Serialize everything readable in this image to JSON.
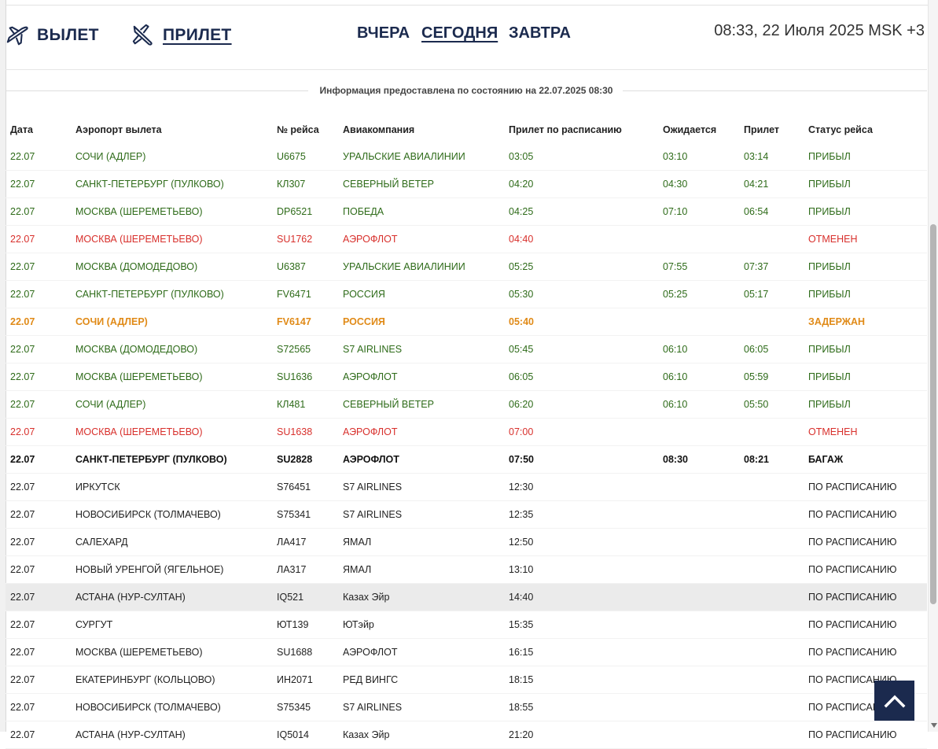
{
  "header": {
    "departure_label": "ВЫЛЕТ",
    "arrival_label": "ПРИЛЕТ",
    "days": {
      "yesterday": "ВЧЕРА",
      "today": "СЕГОДНЯ",
      "tomorrow": "ЗАВТРА"
    },
    "clock": "08:33, 22 Июля 2025 MSK +3"
  },
  "info_text": "Информация предоставлена по состоянию на 22.07.2025 08:30",
  "columns": {
    "date": "Дата",
    "airport": "Аэропорт вылета",
    "flight": "№ рейса",
    "airline": "Авиакомпания",
    "scheduled": "Прилет по расписанию",
    "expected": "Ожидается",
    "arrived": "Прилет",
    "status": "Статус рейса"
  },
  "colors": {
    "navy": "#1b2a4e",
    "arrived": "#2e6b19",
    "cancelled": "#d8302c",
    "delayed": "#e08a17"
  },
  "flights": [
    {
      "date": "22.07",
      "airport": "СОЧИ (АДЛЕР)",
      "flight": "U6675",
      "airline": "УРАЛЬСКИЕ АВИАЛИНИИ",
      "scheduled": "03:05",
      "expected": "03:10",
      "arrived": "03:14",
      "status": "ПРИБЫЛ",
      "state": "ok"
    },
    {
      "date": "22.07",
      "airport": "САНКТ-ПЕТЕРБУРГ (ПУЛКОВО)",
      "flight": "КЛ307",
      "airline": "СЕВЕРНЫЙ ВЕТЕР",
      "scheduled": "04:20",
      "expected": "04:30",
      "arrived": "04:21",
      "status": "ПРИБЫЛ",
      "state": "ok"
    },
    {
      "date": "22.07",
      "airport": "МОСКВА (ШЕРЕМЕТЬЕВО)",
      "flight": "DP6521",
      "airline": "ПОБЕДА",
      "scheduled": "04:25",
      "expected": "07:10",
      "arrived": "06:54",
      "status": "ПРИБЫЛ",
      "state": "ok"
    },
    {
      "date": "22.07",
      "airport": "МОСКВА (ШЕРЕМЕТЬЕВО)",
      "flight": "SU1762",
      "airline": "АЭРОФЛОТ",
      "scheduled": "04:40",
      "expected": "",
      "arrived": "",
      "status": "ОТМЕНЕН",
      "state": "cancel"
    },
    {
      "date": "22.07",
      "airport": "МОСКВА (ДОМОДЕДОВО)",
      "flight": "U6387",
      "airline": "УРАЛЬСКИЕ АВИАЛИНИИ",
      "scheduled": "05:25",
      "expected": "07:55",
      "arrived": "07:37",
      "status": "ПРИБЫЛ",
      "state": "ok"
    },
    {
      "date": "22.07",
      "airport": "САНКТ-ПЕТЕРБУРГ (ПУЛКОВО)",
      "flight": "FV6471",
      "airline": "РОССИЯ",
      "scheduled": "05:30",
      "expected": "05:25",
      "arrived": "05:17",
      "status": "ПРИБЫЛ",
      "state": "ok"
    },
    {
      "date": "22.07",
      "airport": "СОЧИ (АДЛЕР)",
      "flight": "FV6147",
      "airline": "РОССИЯ",
      "scheduled": "05:40",
      "expected": "",
      "arrived": "",
      "status": "ЗАДЕРЖАН",
      "state": "delay"
    },
    {
      "date": "22.07",
      "airport": "МОСКВА (ДОМОДЕДОВО)",
      "flight": "S72565",
      "airline": "S7 AIRLINES",
      "scheduled": "05:45",
      "expected": "06:10",
      "arrived": "06:05",
      "status": "ПРИБЫЛ",
      "state": "ok"
    },
    {
      "date": "22.07",
      "airport": "МОСКВА (ШЕРЕМЕТЬЕВО)",
      "flight": "SU1636",
      "airline": "АЭРОФЛОТ",
      "scheduled": "06:05",
      "expected": "06:10",
      "arrived": "05:59",
      "status": "ПРИБЫЛ",
      "state": "ok"
    },
    {
      "date": "22.07",
      "airport": "СОЧИ (АДЛЕР)",
      "flight": "КЛ481",
      "airline": "СЕВЕРНЫЙ ВЕТЕР",
      "scheduled": "06:20",
      "expected": "06:10",
      "arrived": "05:50",
      "status": "ПРИБЫЛ",
      "state": "ok"
    },
    {
      "date": "22.07",
      "airport": "МОСКВА (ШЕРЕМЕТЬЕВО)",
      "flight": "SU1638",
      "airline": "АЭРОФЛОТ",
      "scheduled": "07:00",
      "expected": "",
      "arrived": "",
      "status": "ОТМЕНЕН",
      "state": "cancel"
    },
    {
      "date": "22.07",
      "airport": "САНКТ-ПЕТЕРБУРГ (ПУЛКОВО)",
      "flight": "SU2828",
      "airline": "АЭРОФЛОТ",
      "scheduled": "07:50",
      "expected": "08:30",
      "arrived": "08:21",
      "status": "БАГАЖ",
      "state": "bold"
    },
    {
      "date": "22.07",
      "airport": "ИРКУТСК",
      "flight": "S76451",
      "airline": "S7 AIRLINES",
      "scheduled": "12:30",
      "expected": "",
      "arrived": "",
      "status": "ПО РАСПИСАНИЮ",
      "state": "normal"
    },
    {
      "date": "22.07",
      "airport": "НОВОСИБИРСК (ТОЛМАЧЕВО)",
      "flight": "S75341",
      "airline": "S7 AIRLINES",
      "scheduled": "12:35",
      "expected": "",
      "arrived": "",
      "status": "ПО РАСПИСАНИЮ",
      "state": "normal"
    },
    {
      "date": "22.07",
      "airport": "САЛЕХАРД",
      "flight": "ЛА417",
      "airline": "ЯМАЛ",
      "scheduled": "12:50",
      "expected": "",
      "arrived": "",
      "status": "ПО РАСПИСАНИЮ",
      "state": "normal"
    },
    {
      "date": "22.07",
      "airport": "НОВЫЙ УРЕНГОЙ (ЯГЕЛЬНОЕ)",
      "flight": "ЛА317",
      "airline": "ЯМАЛ",
      "scheduled": "13:10",
      "expected": "",
      "arrived": "",
      "status": "ПО РАСПИСАНИЮ",
      "state": "normal"
    },
    {
      "date": "22.07",
      "airport": "АСТАНА (НУР-СУЛТАН)",
      "flight": "IQ521",
      "airline": "Казах Эйр",
      "scheduled": "14:40",
      "expected": "",
      "arrived": "",
      "status": "ПО РАСПИСАНИЮ",
      "state": "normal",
      "highlight": true
    },
    {
      "date": "22.07",
      "airport": "СУРГУТ",
      "flight": "ЮТ139",
      "airline": "ЮТэйр",
      "scheduled": "15:35",
      "expected": "",
      "arrived": "",
      "status": "ПО РАСПИСАНИЮ",
      "state": "normal"
    },
    {
      "date": "22.07",
      "airport": "МОСКВА (ШЕРЕМЕТЬЕВО)",
      "flight": "SU1688",
      "airline": "АЭРОФЛОТ",
      "scheduled": "16:15",
      "expected": "",
      "arrived": "",
      "status": "ПО РАСПИСАНИЮ",
      "state": "normal"
    },
    {
      "date": "22.07",
      "airport": "ЕКАТЕРИНБУРГ (КОЛЬЦОВО)",
      "flight": "ИН2071",
      "airline": "РЕД ВИНГС",
      "scheduled": "18:15",
      "expected": "",
      "arrived": "",
      "status": "ПО РАСПИСАНИЮ",
      "state": "normal"
    },
    {
      "date": "22.07",
      "airport": "НОВОСИБИРСК (ТОЛМАЧЕВО)",
      "flight": "S75345",
      "airline": "S7 AIRLINES",
      "scheduled": "18:55",
      "expected": "",
      "arrived": "",
      "status": "ПО РАСПИСАНИЮ",
      "state": "normal"
    },
    {
      "date": "22.07",
      "airport": "АСТАНА (НУР-СУЛТАН)",
      "flight": "IQ5014",
      "airline": "Казах Эйр",
      "scheduled": "21:20",
      "expected": "",
      "arrived": "",
      "status": "ПО РАСПИСАНИЮ",
      "state": "normal"
    }
  ],
  "icons": {
    "departure": "plane-takeoff-icon",
    "arrival": "plane-landing-icon",
    "scroll_top": "chevron-up-icon"
  }
}
